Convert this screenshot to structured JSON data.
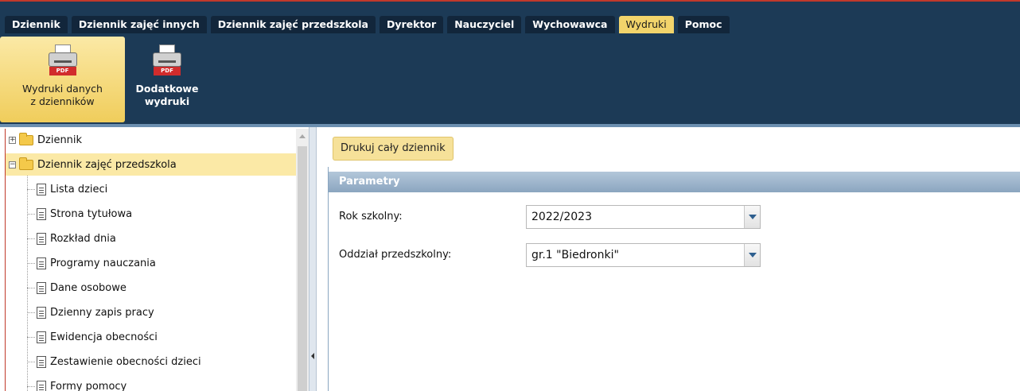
{
  "tabs": [
    {
      "label": "Dziennik",
      "active": false
    },
    {
      "label": "Dziennik zajęć innych",
      "active": false
    },
    {
      "label": "Dziennik zajęć przedszkola",
      "active": false
    },
    {
      "label": "Dyrektor",
      "active": false
    },
    {
      "label": "Nauczyciel",
      "active": false
    },
    {
      "label": "Wychowawca",
      "active": false
    },
    {
      "label": "Wydruki",
      "active": true
    },
    {
      "label": "Pomoc",
      "active": false
    }
  ],
  "ribbon": {
    "buttons": [
      {
        "line1": "Wydruki danych",
        "line2": "z dzienników",
        "icon": "printer-pdf-icon",
        "badge": "PDF",
        "selected": true
      },
      {
        "line1": "Dodatkowe",
        "line2": "wydruki",
        "icon": "printer-pdf-icon",
        "badge": "PDF",
        "selected": false
      }
    ]
  },
  "tree": {
    "nodes": [
      {
        "label": "Dziennik",
        "type": "folder",
        "expanded": false
      },
      {
        "label": "Dziennik zajęć przedszkola",
        "type": "folder-open",
        "expanded": true,
        "selected": true
      },
      {
        "label": "Lista dzieci",
        "type": "document"
      },
      {
        "label": "Strona tytułowa",
        "type": "document"
      },
      {
        "label": "Rozkład dnia",
        "type": "document"
      },
      {
        "label": "Programy nauczania",
        "type": "document"
      },
      {
        "label": "Dane osobowe",
        "type": "document"
      },
      {
        "label": "Dzienny zapis pracy",
        "type": "document"
      },
      {
        "label": "Ewidencja obecności",
        "type": "document"
      },
      {
        "label": "Zestawienie obecności dzieci",
        "type": "document"
      },
      {
        "label": "Formy pomocy",
        "type": "document"
      }
    ]
  },
  "toolbar": {
    "print_all": "Drukuj cały dziennik"
  },
  "params": {
    "title": "Parametry",
    "fields": [
      {
        "label": "Rok szkolny:",
        "value": "2022/2023"
      },
      {
        "label": "Oddział przedszkolny:",
        "value": "gr.1 \"Biedronki\""
      }
    ]
  },
  "colors": {
    "top_bar": "#1c3a56",
    "active_tab": "#f2d46b",
    "selection": "#fbe9a6",
    "header_bar": "#8ba5bf",
    "pdf_badge": "#d12c2c"
  }
}
